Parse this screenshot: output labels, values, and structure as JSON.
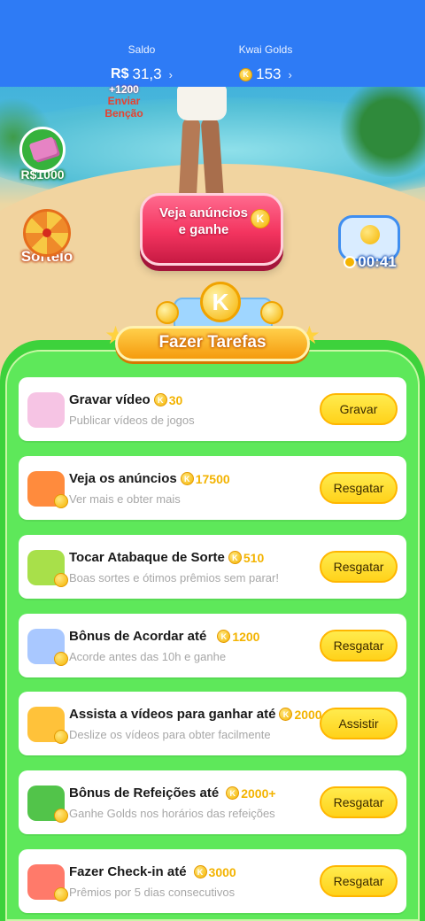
{
  "header": {
    "saldo_label": "Saldo",
    "saldo_currency": "R$",
    "saldo_value": "31,3",
    "golds_label": "Kwai Golds",
    "golds_value": "153",
    "chevron": "›"
  },
  "blessing": {
    "amount": "+1200",
    "label": "Enviar Benção"
  },
  "widgets": {
    "money_label": "R$1000",
    "sorteio_label": "Sorteio",
    "timer_value": "00:41"
  },
  "ad_button": {
    "label": "Veja anúncios e ganhe",
    "coin": "K"
  },
  "tasks_banner": {
    "title": "Fazer Tarefas",
    "coin": "K"
  },
  "tasks": [
    {
      "title": "Gravar vídeo",
      "reward": "30",
      "subtitle": "Publicar vídeos de jogos",
      "button": "Gravar",
      "icon": "video-record-icon"
    },
    {
      "title": "Veja os anúncios",
      "reward": "17500",
      "subtitle": "Ver mais e obter mais",
      "button": "Resgatar",
      "icon": "tv-icon"
    },
    {
      "title": "Tocar Atabaque de Sorte",
      "reward": "510",
      "subtitle": "Boas sortes e ótimos prêmios sem parar!",
      "button": "Resgatar",
      "icon": "drum-icon"
    },
    {
      "title": "Bônus de Acordar até",
      "reward": "1200",
      "subtitle": "Acorde antes das 10h e ganhe",
      "button": "Resgatar",
      "icon": "moon-icon"
    },
    {
      "title": "Assista a vídeos para ganhar até",
      "reward": "2000",
      "subtitle": "Deslize os vídeos para obter facilmente",
      "button": "Assistir",
      "icon": "camera-icon"
    },
    {
      "title": "Bônus de Refeições até",
      "reward": "2000+",
      "subtitle": "Ganhe Golds nos horários das refeições",
      "button": "Resgatar",
      "icon": "meal-icon"
    },
    {
      "title": "Fazer Check-in até",
      "reward": "3000",
      "subtitle": "Prêmios por 5 dias consecutivos",
      "button": "Resgatar",
      "icon": "calendar-icon"
    }
  ],
  "colors": {
    "topbar": "#2e7bf5",
    "panel": "#3dd23c",
    "button": "#ffd21a",
    "coin": "#f5b400"
  }
}
